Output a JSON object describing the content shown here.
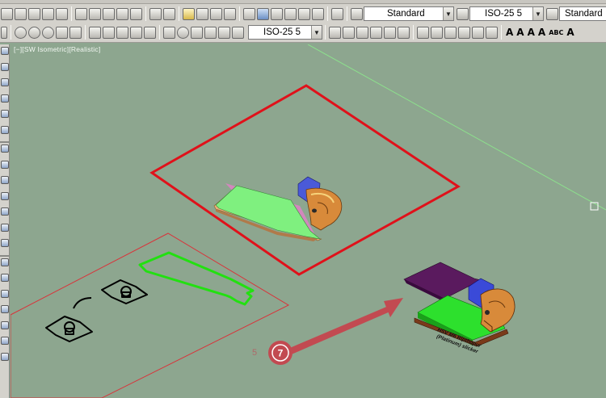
{
  "toolbar_top": {
    "text_style_combo": "Standard",
    "dim_style_combo": "ISO-25 5",
    "table_style_combo": "Standard"
  },
  "toolbar_second": {
    "dim_combo": "ISO-25 5",
    "glyphs": [
      "A",
      "A",
      "A",
      "A",
      "ABC",
      "A"
    ]
  },
  "viewport": {
    "label": "[−][SW Isometric][Realistic]"
  },
  "annotations": {
    "callout_number": "7",
    "side_number": "5",
    "model_label_line1": "HSV M6 Ripthopur",
    "model_label_line2": "(Platinum) slicker"
  },
  "colors": {
    "viewport_background": "#8da68f",
    "boundary_red": "#e0111a",
    "profile_green": "#22e011",
    "callout_fill": "#c24a51",
    "axis_line": "#8de08d"
  }
}
